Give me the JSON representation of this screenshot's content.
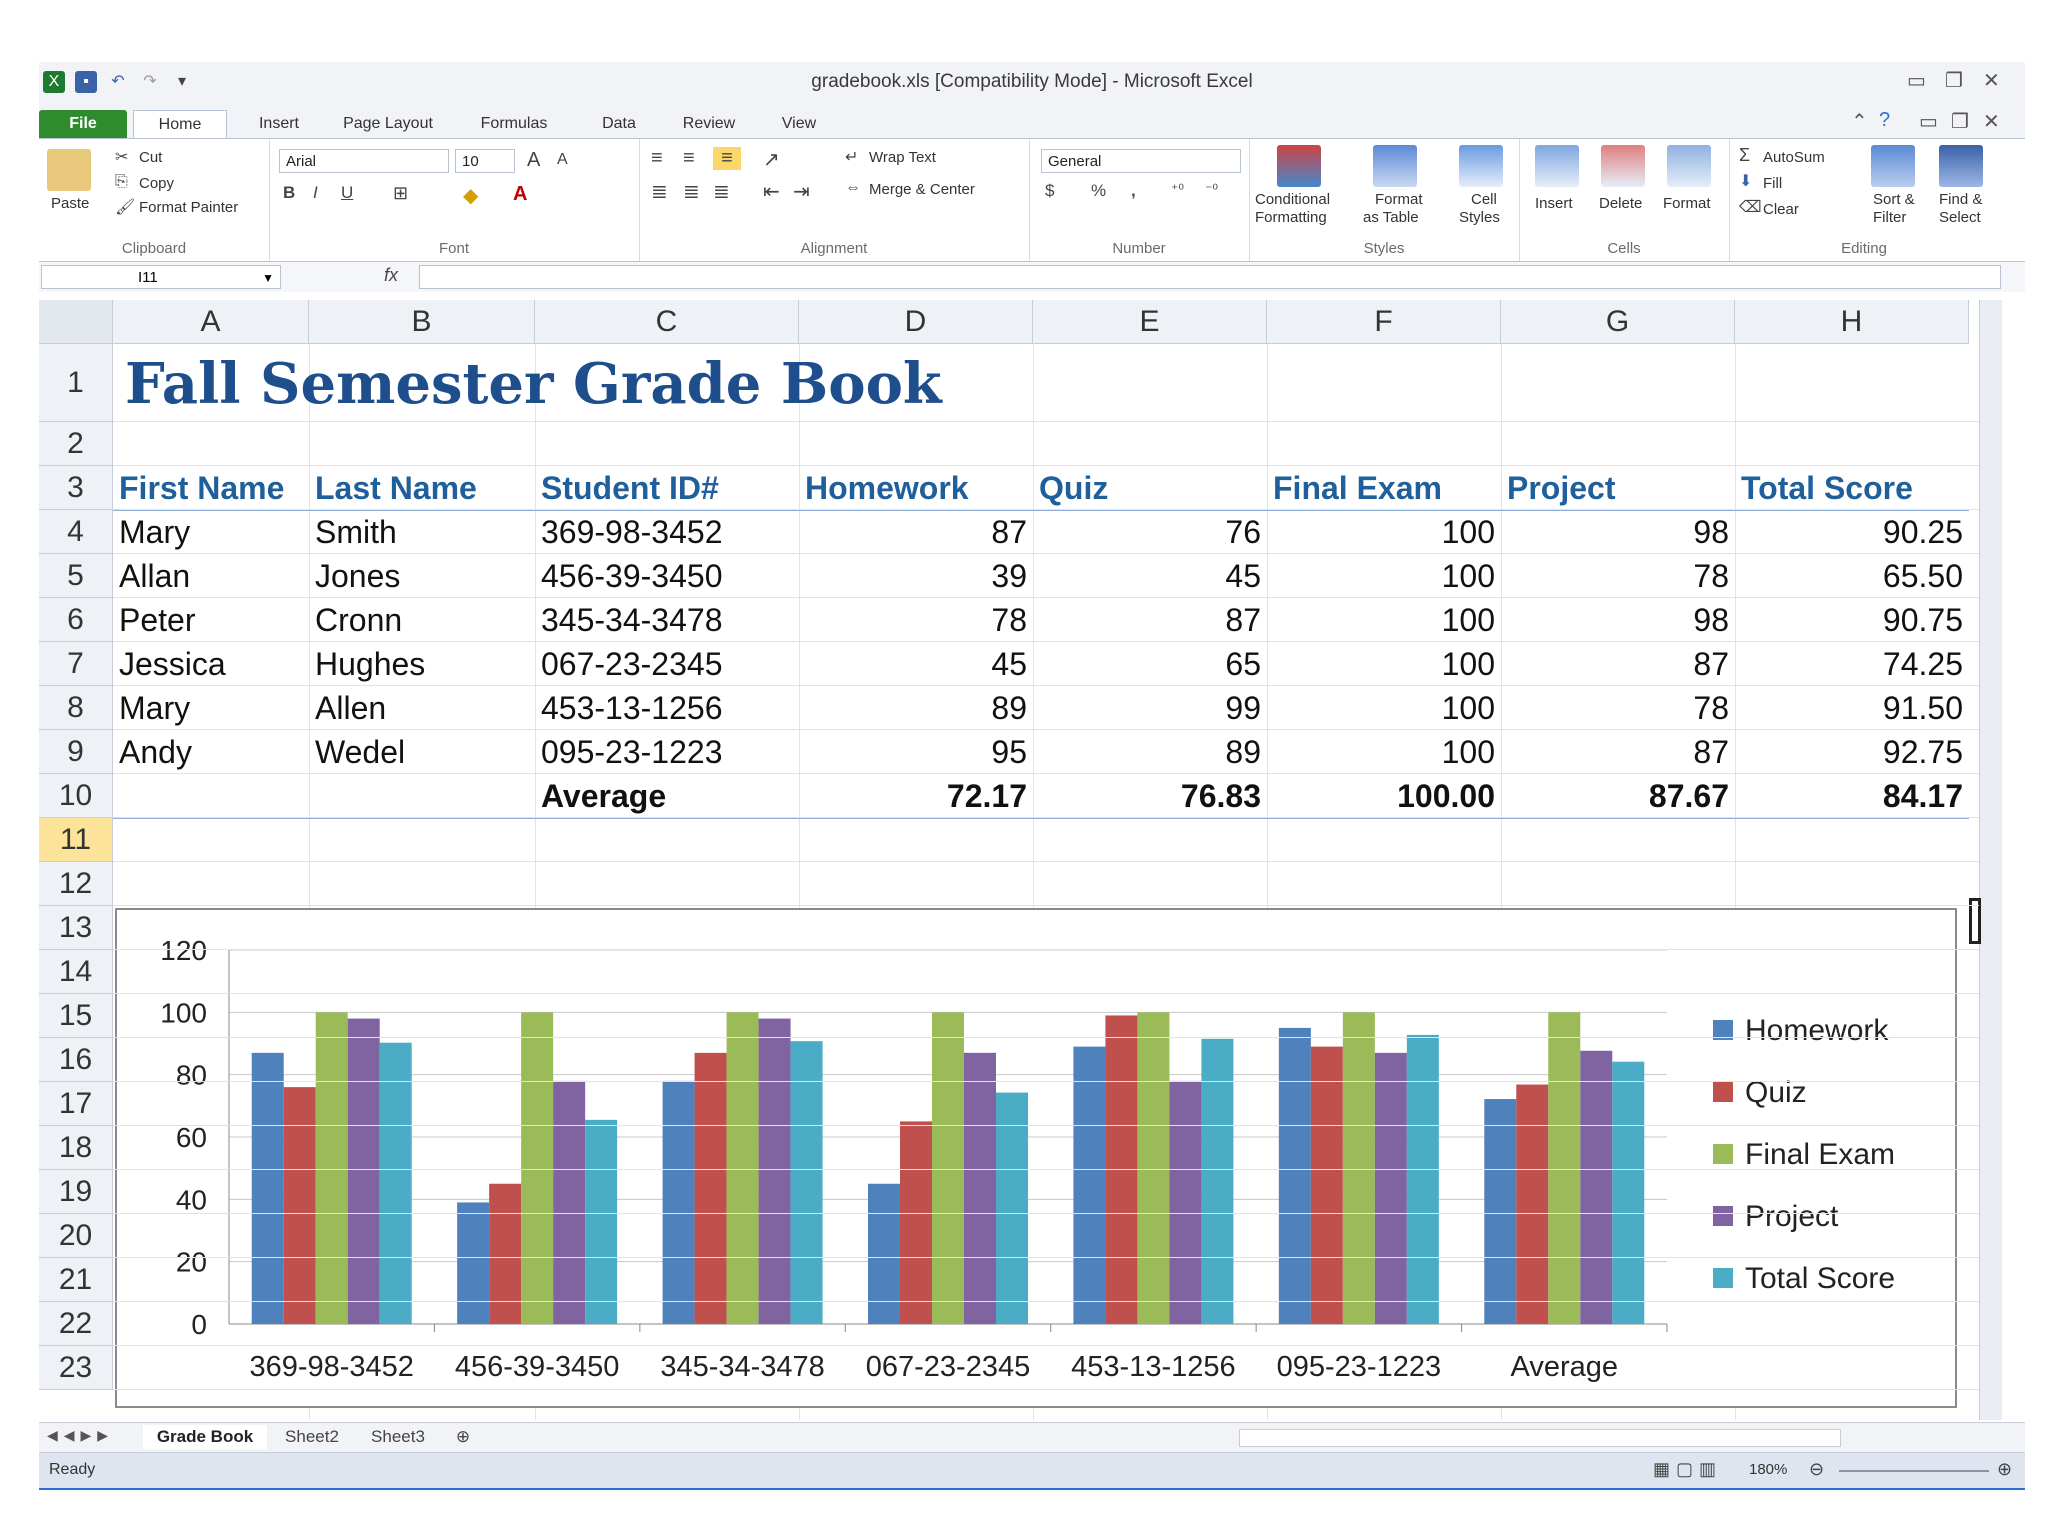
{
  "window": {
    "title": "gradebook.xls  [Compatibility Mode]  -  Microsoft Excel"
  },
  "tabs": [
    "File",
    "Home",
    "Insert",
    "Page Layout",
    "Formulas",
    "Data",
    "Review",
    "View"
  ],
  "ribbon": {
    "clipboard": {
      "label": "Clipboard",
      "paste": "Paste",
      "cut": "Cut",
      "copy": "Copy",
      "format_painter": "Format Painter"
    },
    "font": {
      "label": "Font",
      "name": "Arial",
      "size": "10",
      "bold": "B",
      "italic": "I",
      "underline": "U"
    },
    "alignment": {
      "label": "Alignment",
      "wrap_text": "Wrap Text",
      "merge_center": "Merge & Center"
    },
    "number": {
      "label": "Number",
      "format": "General",
      "currency": "$",
      "percent": "%",
      "comma": ","
    },
    "styles": {
      "label": "Styles",
      "conditional": "Conditional",
      "formatting": "Formatting",
      "format": "Format",
      "as_table": "as Table",
      "cell": "Cell",
      "cell_styles": "Styles"
    },
    "cells": {
      "label": "Cells",
      "insert": "Insert",
      "delete": "Delete",
      "format": "Format"
    },
    "editing": {
      "label": "Editing",
      "autosum": "AutoSum",
      "fill": "Fill",
      "clear": "Clear",
      "sort": "Sort &",
      "filter": "Filter",
      "find": "Find &",
      "select": "Select"
    }
  },
  "formula_bar": {
    "name_box": "I11",
    "fx": "fx",
    "content": ""
  },
  "columns": [
    "A",
    "B",
    "C",
    "D",
    "E",
    "F",
    "G",
    "H"
  ],
  "rows": [
    "1",
    "2",
    "3",
    "4",
    "5",
    "6",
    "7",
    "8",
    "9",
    "10",
    "11",
    "12",
    "13",
    "14",
    "15",
    "16",
    "17",
    "18",
    "19",
    "20",
    "21",
    "22",
    "23"
  ],
  "sheet": {
    "title": "Fall Semester Grade Book",
    "headers": [
      "First Name",
      "Last Name",
      "Student ID#",
      "Homework",
      "Quiz",
      "Final Exam",
      "Project",
      "Total Score"
    ],
    "students": [
      [
        "Mary",
        "Smith",
        "369-98-3452",
        "87",
        "76",
        "100",
        "98",
        "90.25"
      ],
      [
        "Allan",
        "Jones",
        "456-39-3450",
        "39",
        "45",
        "100",
        "78",
        "65.50"
      ],
      [
        "Peter",
        "Cronn",
        "345-34-3478",
        "78",
        "87",
        "100",
        "98",
        "90.75"
      ],
      [
        "Jessica",
        "Hughes",
        "067-23-2345",
        "45",
        "65",
        "100",
        "87",
        "74.25"
      ],
      [
        "Mary",
        "Allen",
        "453-13-1256",
        "89",
        "99",
        "100",
        "78",
        "91.50"
      ],
      [
        "Andy",
        "Wedel",
        "095-23-1223",
        "95",
        "89",
        "100",
        "87",
        "92.75"
      ]
    ],
    "average_row": [
      "",
      "",
      "Average",
      "72.17",
      "76.83",
      "100.00",
      "87.67",
      "84.17"
    ]
  },
  "chart_data": {
    "type": "bar",
    "categories": [
      "369-98-3452",
      "456-39-3450",
      "345-34-3478",
      "067-23-2345",
      "453-13-1256",
      "095-23-1223",
      "Average"
    ],
    "series": [
      {
        "name": "Homework",
        "color": "#4f81bd",
        "values": [
          87,
          39,
          78,
          45,
          89,
          95,
          72.17
        ]
      },
      {
        "name": "Quiz",
        "color": "#c0504d",
        "values": [
          76,
          45,
          87,
          65,
          99,
          89,
          76.83
        ]
      },
      {
        "name": "Final Exam",
        "color": "#9bbb59",
        "values": [
          100,
          100,
          100,
          100,
          100,
          100,
          100
        ]
      },
      {
        "name": "Project",
        "color": "#8064a2",
        "values": [
          98,
          78,
          98,
          87,
          78,
          87,
          87.67
        ]
      },
      {
        "name": "Total Score",
        "color": "#4bacc6",
        "values": [
          90.25,
          65.5,
          90.75,
          74.25,
          91.5,
          92.75,
          84.17
        ]
      }
    ],
    "yticks": [
      "0",
      "20",
      "40",
      "60",
      "80",
      "100",
      "120"
    ],
    "ylim": [
      0,
      120
    ],
    "grid": true,
    "legend": "right"
  },
  "sheet_tabs": [
    "Grade Book",
    "Sheet2",
    "Sheet3"
  ],
  "status": {
    "ready": "Ready",
    "zoom": "180%"
  },
  "colors": {
    "header_blue": "#1f5f9c",
    "title_blue": "#1f4e8c",
    "file_tab": "#2e8b2e",
    "selected_row": "#fbe49a"
  }
}
